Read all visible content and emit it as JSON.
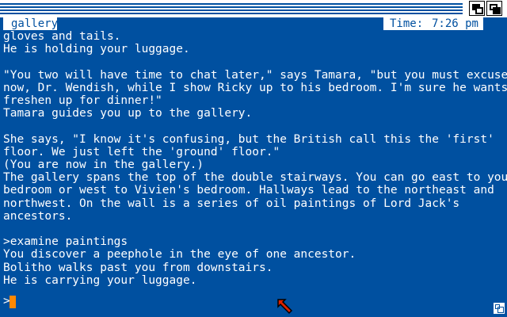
{
  "status": {
    "room": "gallery",
    "time_label": "Time:",
    "time_value": "7:26 pm"
  },
  "transcript": [
    "gloves and tails.",
    "He is holding your luggage.",
    "",
    "\"You two will have time to chat later,\" says Tamara, \"but you must excuse us",
    "now, Dr. Wendish, while I show Ricky up to his bedroom. I'm sure he wants to",
    "freshen up for dinner!\"",
    "Tamara guides you up to the gallery.",
    "",
    "She says, \"I know it's confusing, but the British call this the 'first'",
    "floor. We just left the 'ground' floor.\"",
    "(You are now in the gallery.)",
    "The gallery spans the top of the double stairways. You can go east to your",
    "bedroom or west to Vivien's bedroom. Hallways lead to the northeast and",
    "northwest. On the wall is a series of oil paintings of Lord Jack's",
    "ancestors.",
    "",
    ">examine paintings",
    "You discover a peephole in the eye of one ancestor.",
    "Bolitho walks past you from downstairs.",
    "He is carrying your luggage."
  ],
  "prompt": {
    "symbol": ">"
  },
  "icons": {
    "depth_back": "window-back-icon",
    "depth_front": "window-front-icon",
    "pointer": "mouse-pointer-icon",
    "sizer": "resize-icon"
  },
  "colors": {
    "background": "#0050a0",
    "text": "#ffffff",
    "cursor": "#ff8800",
    "pointer": "#dd2200"
  }
}
